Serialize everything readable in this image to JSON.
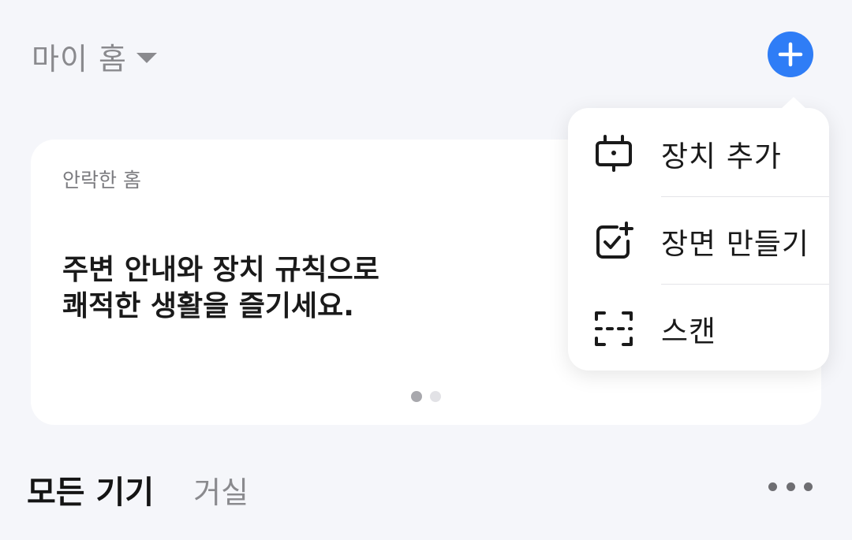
{
  "header": {
    "home_title": "마이 홈",
    "home_dropdown_icon": "caret-down-icon",
    "add_button_icon": "plus-icon",
    "accent_color": "#2f7df6"
  },
  "banner": {
    "subtitle": "안락한 홈",
    "lines": [
      "주변 안내와 장치 규칙으로",
      "쾌적한 생활을 즐기세요."
    ],
    "pager": {
      "count": 2,
      "active_index": 0
    }
  },
  "tabs": {
    "all_devices": "모든 기기",
    "living_room": "거실",
    "more_icon": "more-horizontal-icon"
  },
  "menu": {
    "items": [
      {
        "label": "장치 추가",
        "icon": "device-add-icon"
      },
      {
        "label": "장면 만들기",
        "icon": "scene-create-icon"
      },
      {
        "label": "스캔",
        "icon": "scan-icon"
      }
    ]
  }
}
